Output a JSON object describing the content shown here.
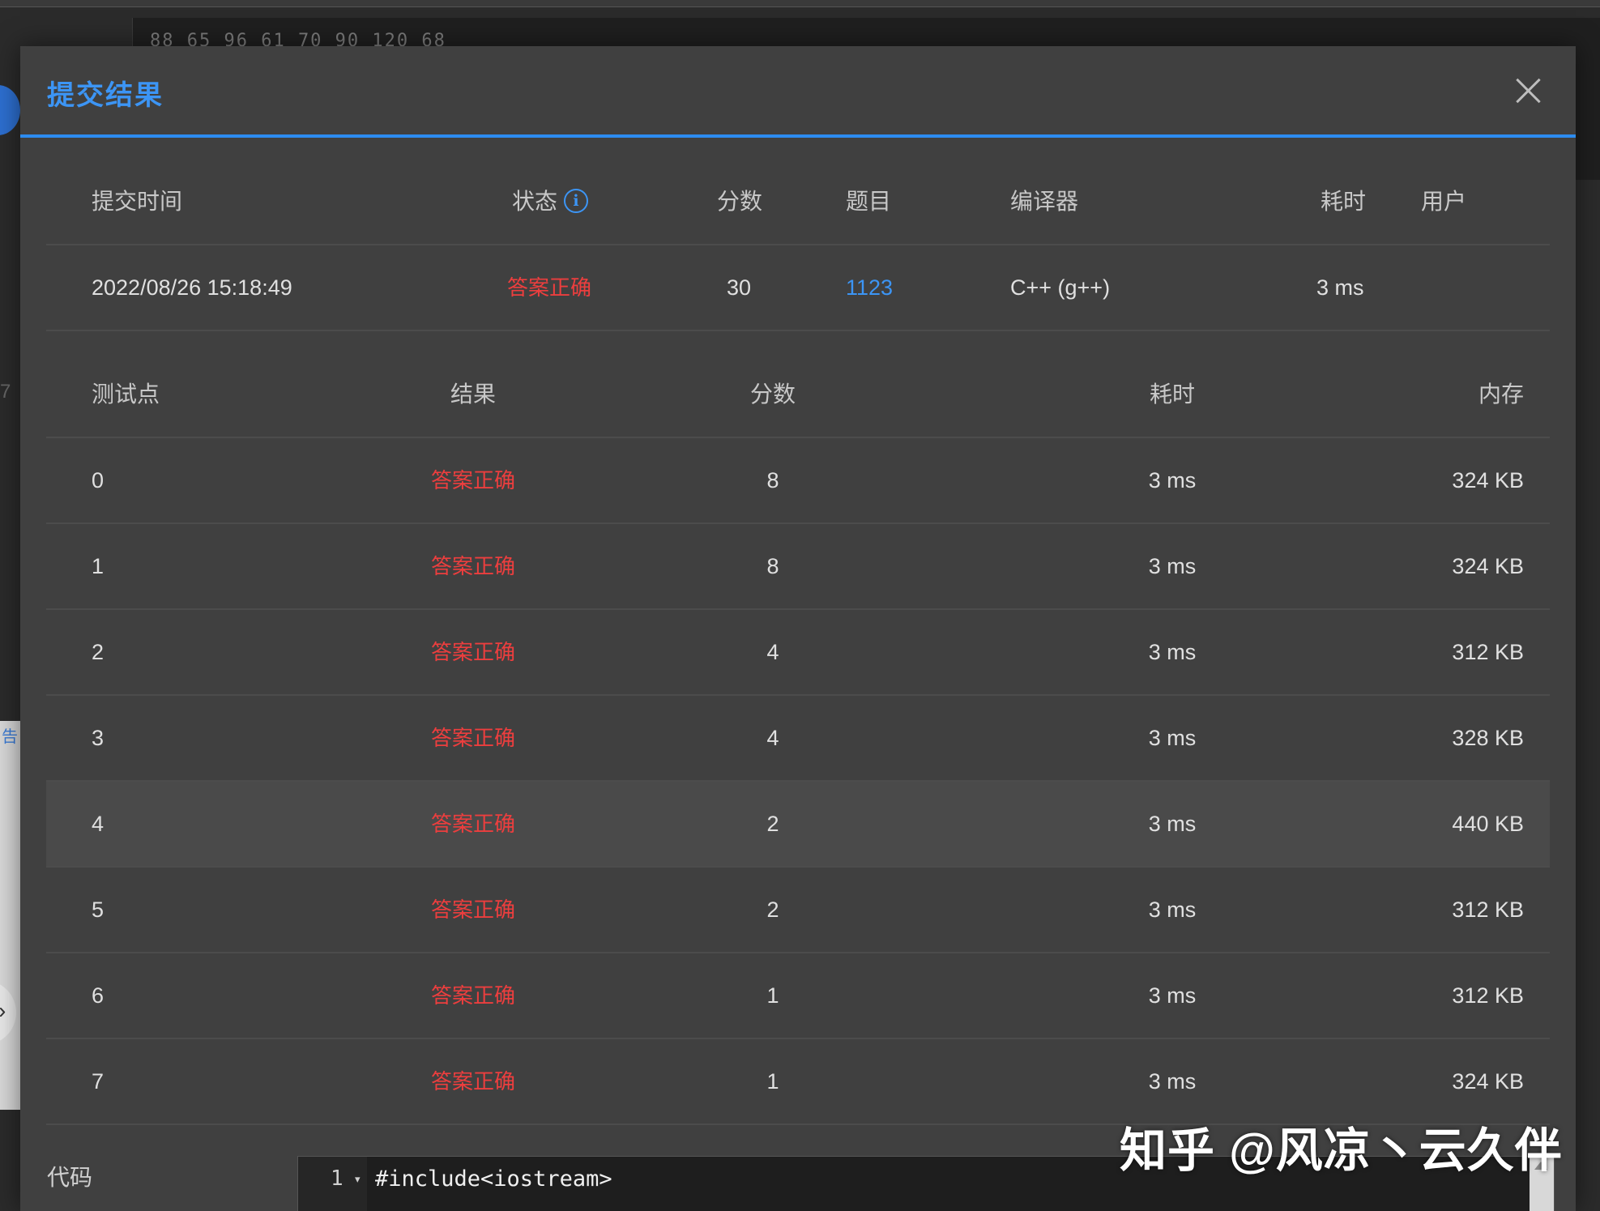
{
  "background": {
    "code_hint": "88 65 96 61 70 90 120 68",
    "left_number": "7",
    "left_tag": "告",
    "chevron_glyph": "›"
  },
  "modal": {
    "title": "提交结果",
    "close_icon": "close-icon"
  },
  "summary": {
    "headers": {
      "submit_time": "提交时间",
      "status": "状态",
      "score": "分数",
      "problem": "题目",
      "compiler": "编译器",
      "time": "耗时",
      "user": "用户"
    },
    "row": {
      "submit_time": "2022/08/26 15:18:49",
      "status": "答案正确",
      "score": "30",
      "problem": "1123",
      "compiler": "C++ (g++)",
      "time": "3 ms",
      "user": ""
    }
  },
  "testcases": {
    "headers": {
      "case": "测试点",
      "result": "结果",
      "score": "分数",
      "time": "耗时",
      "memory": "内存"
    },
    "rows": [
      {
        "case": "0",
        "result": "答案正确",
        "score": "8",
        "time": "3 ms",
        "memory": "324 KB"
      },
      {
        "case": "1",
        "result": "答案正确",
        "score": "8",
        "time": "3 ms",
        "memory": "324 KB"
      },
      {
        "case": "2",
        "result": "答案正确",
        "score": "4",
        "time": "3 ms",
        "memory": "312 KB"
      },
      {
        "case": "3",
        "result": "答案正确",
        "score": "4",
        "time": "3 ms",
        "memory": "328 KB"
      },
      {
        "case": "4",
        "result": "答案正确",
        "score": "2",
        "time": "3 ms",
        "memory": "440 KB"
      },
      {
        "case": "5",
        "result": "答案正确",
        "score": "2",
        "time": "3 ms",
        "memory": "312 KB"
      },
      {
        "case": "6",
        "result": "答案正确",
        "score": "1",
        "time": "3 ms",
        "memory": "312 KB"
      },
      {
        "case": "7",
        "result": "答案正确",
        "score": "1",
        "time": "3 ms",
        "memory": "324 KB"
      }
    ]
  },
  "code": {
    "label": "代码",
    "line_number": "1",
    "fold_glyph": "▾",
    "first_line": "#include<iostream>"
  },
  "watermark": "知乎 @风凉丶云久伴",
  "colors": {
    "accent": "#2d8cf0",
    "ok": "#ed3e3e",
    "modal_bg": "#404040"
  }
}
